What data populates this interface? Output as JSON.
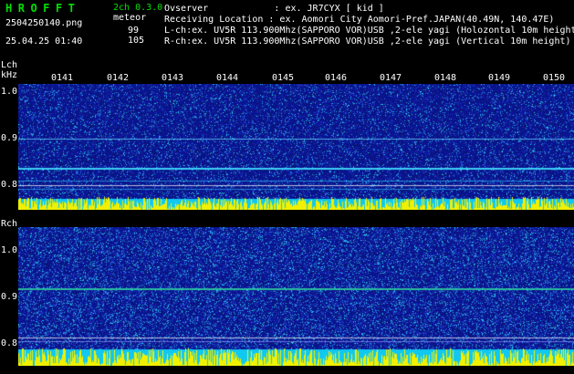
{
  "header": {
    "logo": "HROFFT",
    "filename": "2504250140.png",
    "datetime": "25.04.25 01:40",
    "version": "2ch 0.3.0",
    "meteor_label": "meteor",
    "count_l": "99",
    "count_r": "105"
  },
  "info": {
    "observer": "Ovserver            : ex. JR7CYX [ kid ]",
    "location": "Receiving Location : ex. Aomori City Aomori-Pref.JAPAN(40.49N, 140.47E)",
    "lch": "L-ch:ex. UV5R 113.900Mhz(SAPPORO VOR)USB ,2-ele yagi (Holozontal 10m height)",
    "rch": "R-ch:ex. UV5R 113.900Mhz(SAPPORO VOR)USB ,2-ele yagi (Vertical 10m height)"
  },
  "left_channel": {
    "label": "Lch",
    "unit": "kHz",
    "ticks": [
      "1.0",
      "0.9",
      "0.8"
    ]
  },
  "right_channel": {
    "label": "Rch",
    "ticks": [
      "1.0",
      "0.9",
      "0.8"
    ]
  },
  "time_labels": [
    "0141",
    "0142",
    "0143",
    "0144",
    "0145",
    "0146",
    "0147",
    "0148",
    "0149",
    "0150"
  ],
  "colors": {
    "background": "#000000",
    "logo": "#00e000",
    "spectrogram_base": "#0a1a8a",
    "signal_line": "#00e0ff",
    "meteor_bars": "#ffff00"
  }
}
